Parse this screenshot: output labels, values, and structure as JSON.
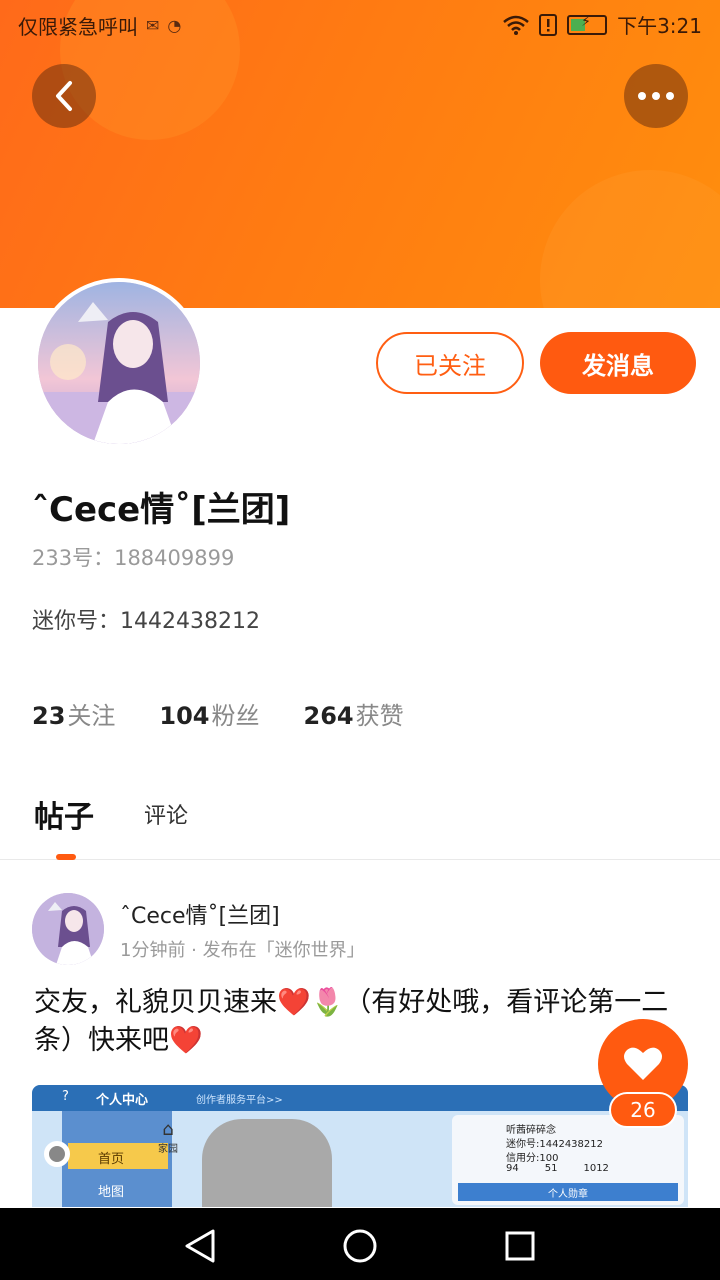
{
  "status_bar": {
    "carrier": "仅限紧急呼叫",
    "time": "下午3:21",
    "icons": [
      "mail-icon",
      "notification-icon",
      "wifi-icon",
      "alert-icon",
      "battery-charging-icon"
    ]
  },
  "header": {
    "back_icon": "chevron-left-icon",
    "more_icon": "more-dots-icon",
    "banner_color": "#ff7b12"
  },
  "profile": {
    "username": "ˆCece情˚[兰团]",
    "id_233": "233号：188409899",
    "id_mini": "迷你号：1442438212",
    "follow_button": "已关注",
    "message_button": "发消息",
    "stats": [
      {
        "value": "23",
        "label": "关注"
      },
      {
        "value": "104",
        "label": "粉丝"
      },
      {
        "value": "264",
        "label": "获赞"
      }
    ]
  },
  "tabs": {
    "posts": "帖子",
    "comments": "评论",
    "active": "posts"
  },
  "post": {
    "author": "ˆCece情˚[兰团]",
    "meta": "1分钟前 · 发布在「迷你世界」",
    "text_part1": "交友，礼貌贝贝速来",
    "text_part2": "（有好处哦，看评论第一二条）快来吧",
    "heart_emoji": "❤️",
    "tulip_emoji": "🌷",
    "image": {
      "nav_title": "个人中心",
      "help": "?",
      "platform_link": "创作者服务平台>>",
      "menu_home": "首页",
      "menu_map": "地图",
      "home_label": "家园",
      "card_name": "听茜碎碎念",
      "card_mini_id": "迷你号:1442438212",
      "card_credit": "信用分:100",
      "card_stat1": "94",
      "card_stat2": "51",
      "card_stat3": "1012",
      "card_badge": "个人勋章"
    },
    "like_count": "26"
  },
  "colors": {
    "accent": "#ff5a10",
    "text_primary": "#111111",
    "text_secondary": "#9a9a9a"
  }
}
